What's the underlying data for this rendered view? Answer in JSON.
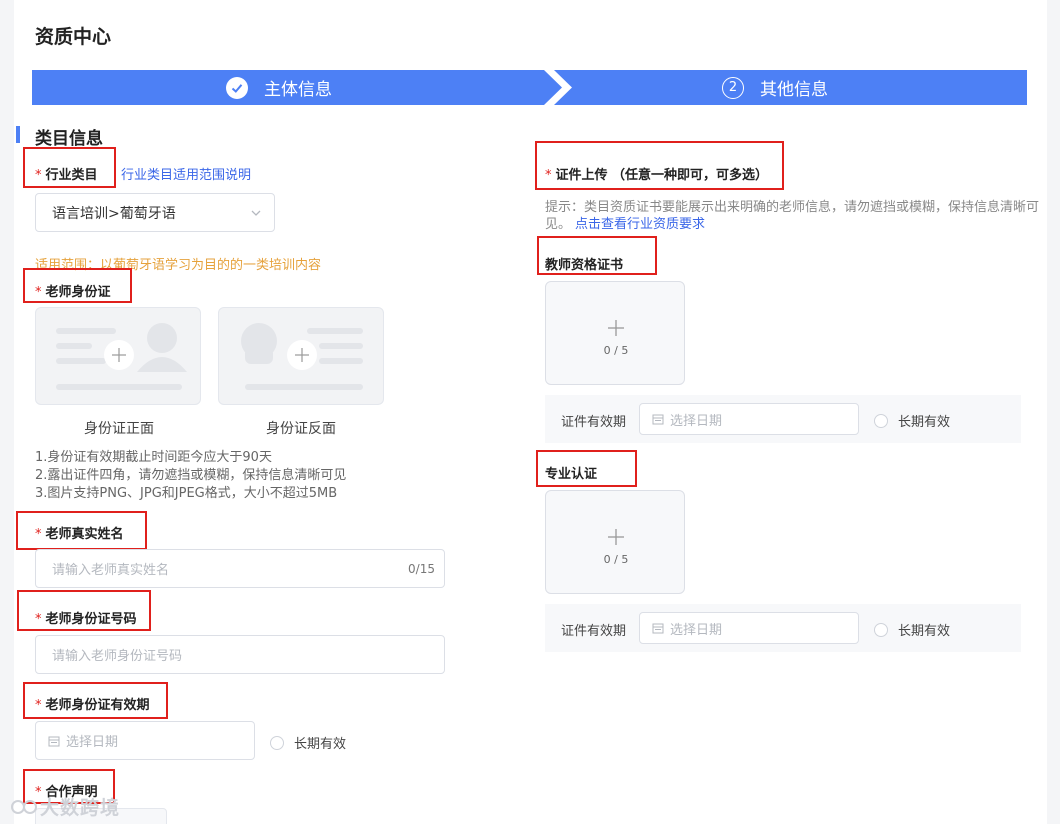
{
  "page": {
    "title": "资质中心"
  },
  "steps": [
    {
      "label": "主体信息",
      "number": "",
      "state": "done"
    },
    {
      "label": "其他信息",
      "number": "2",
      "state": "active"
    }
  ],
  "section": {
    "title": "类目信息"
  },
  "industry": {
    "label": "行业类目",
    "link": "行业类目适用范围说明",
    "selected": "语言培训>葡萄牙语",
    "scope_hint": "适用范围：以葡萄牙语学习为目的的一类培训内容"
  },
  "teacher_id": {
    "label": "老师身份证",
    "front_caption": "身份证正面",
    "back_caption": "身份证反面",
    "notes": [
      "1.身份证有效期截止时间距今应大于90天",
      "2.露出证件四角，请勿遮挡或模糊，保持信息清晰可见",
      "3.图片支持PNG、JPG和JPEG格式，大小不超过5MB"
    ]
  },
  "teacher_name": {
    "label": "老师真实姓名",
    "placeholder": "请输入老师真实姓名",
    "count": "0/15"
  },
  "teacher_id_number": {
    "label": "老师身份证号码",
    "placeholder": "请输入老师身份证号码"
  },
  "teacher_id_validity": {
    "label": "老师身份证有效期",
    "date_placeholder": "选择日期",
    "long_term": "长期有效"
  },
  "cooperation": {
    "label": "合作声明"
  },
  "certificate_upload": {
    "label": "证件上传 （任意一种即可，可多选）",
    "tip": "提示：类目资质证书要能展示出来明确的老师信息，请勿遮挡或模糊，保持信息清晰可见。",
    "tip_link": "点击查看行业资质要求"
  },
  "teacher_cert": {
    "label": "教师资格证书",
    "upload_count": "0 / 5",
    "validity_label": "证件有效期",
    "date_placeholder": "选择日期",
    "long_term": "长期有效"
  },
  "professional_cert": {
    "label": "专业认证",
    "upload_count": "0 / 5",
    "validity_label": "证件有效期",
    "date_placeholder": "选择日期",
    "long_term": "长期有效"
  },
  "watermark": {
    "text": "大数跨境"
  },
  "colors": {
    "primary": "#4d80f5",
    "highlight": "#e0201c",
    "hint": "#e6a23c",
    "link": "#3a66e8"
  }
}
